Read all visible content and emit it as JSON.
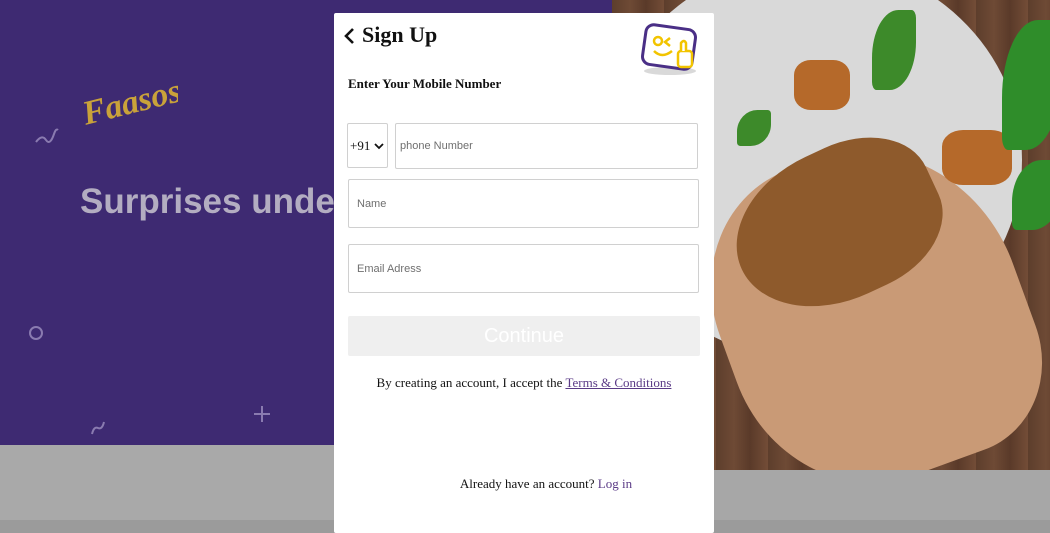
{
  "background": {
    "brand": "Faasos",
    "headline": "Surprises unde",
    "accent": "#3e2a72"
  },
  "modal": {
    "title": "Sign Up",
    "back_icon": "chevron-left-icon",
    "mascot_icon": "winking-thumbs-up-icon",
    "subtitle": "Enter Your Mobile Number",
    "country_code": "+91",
    "phone_placeholder": "phone Number",
    "name_placeholder": "Name",
    "email_placeholder": "Email Adress",
    "continue_label": "Continue",
    "terms_prefix": "By creating an account, I accept the ",
    "terms_link": "Terms & Conditions",
    "login_prefix": "Already have an account? ",
    "login_link": "Log in",
    "link_color": "#5a3a86"
  }
}
